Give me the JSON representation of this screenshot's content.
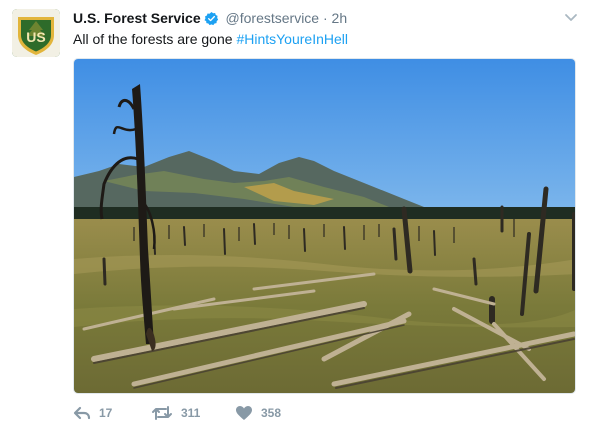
{
  "tweet": {
    "author_name": "U.S. Forest Service",
    "handle": "@forestservice",
    "separator": "·",
    "time": "2h",
    "text": "All of the forests are gone ",
    "hashtag": "#HintsYoureInHell",
    "avatar_text": "US",
    "replies": "17",
    "retweets": "311",
    "likes": "358"
  },
  "colors": {
    "hashtag": "#1da1f2",
    "verified": "#1da1f2",
    "action_icons": "#8899a6",
    "avatar_green": "#2e6b2a",
    "avatar_gold": "#e2b53b"
  },
  "icons": [
    "verified-badge-icon",
    "chevron-down-icon",
    "reply-icon",
    "retweet-icon",
    "like-icon"
  ]
}
